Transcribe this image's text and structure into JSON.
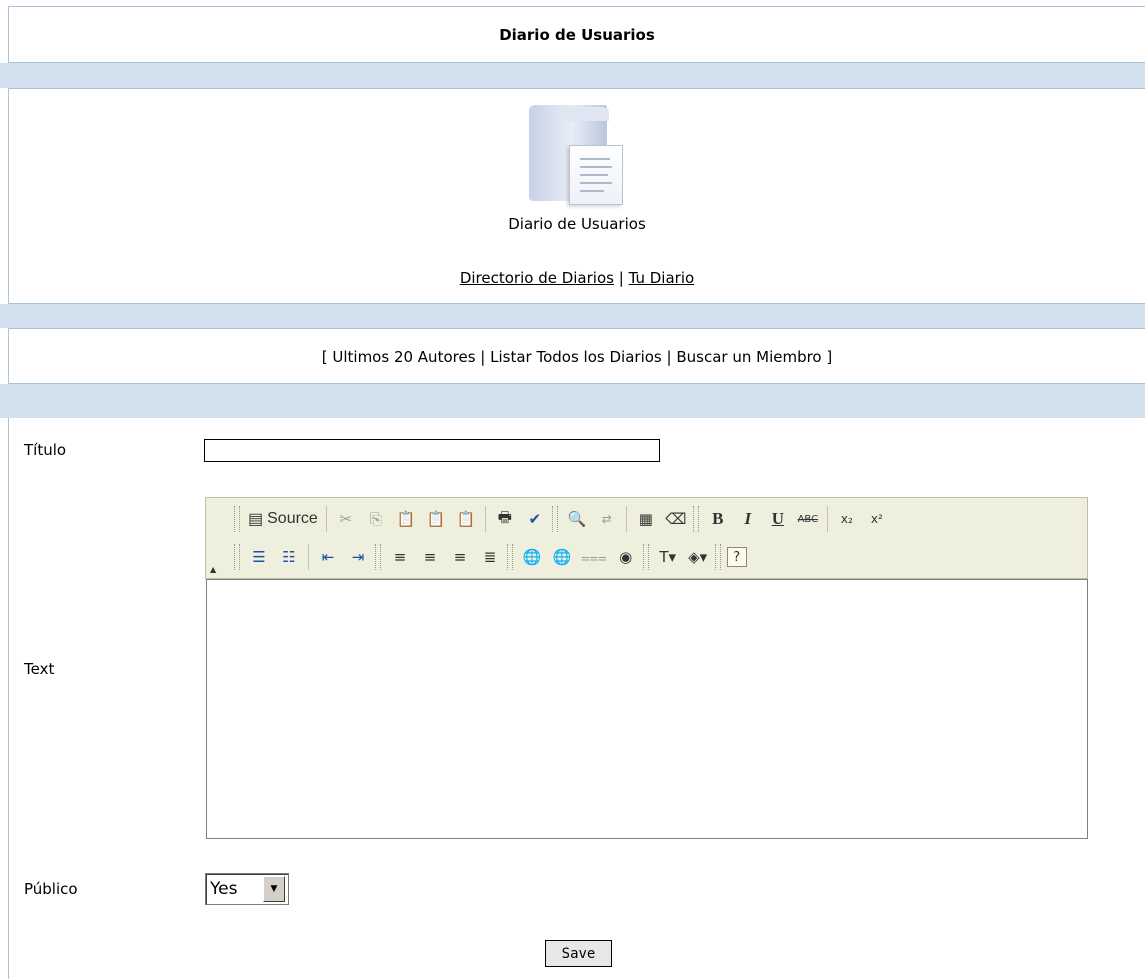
{
  "page_title": "Diario de Usuarios",
  "header": {
    "icon": "folder-document-icon",
    "label": "Diario de Usuarios",
    "links": [
      {
        "label": "Directorio de Diarios"
      },
      {
        "label": "Tu Diario"
      }
    ],
    "link_separator": "|"
  },
  "nav": {
    "open_bracket": "[",
    "close_bracket": "]",
    "separator": "|",
    "items": [
      {
        "label": "Ultimos 20 Autores"
      },
      {
        "label": "Listar Todos los Diarios"
      },
      {
        "label": "Buscar un Miembro"
      }
    ]
  },
  "form": {
    "titulo_label": "Título",
    "titulo_value": "",
    "text_label": "Text",
    "publico_label": "Público",
    "publico_value": "Yes",
    "save_label": "Save"
  },
  "editor": {
    "source_label": "Source",
    "toolbar_row1": [
      "source",
      "cut",
      "copy",
      "paste",
      "paste-text",
      "paste-word",
      "print",
      "spellcheck",
      "find",
      "replace",
      "select-all",
      "remove-format",
      "bold",
      "italic",
      "underline",
      "strikethrough",
      "subscript",
      "superscript"
    ],
    "toolbar_row2": [
      "ordered-list",
      "unordered-list",
      "outdent",
      "indent",
      "align-left",
      "align-center",
      "align-right",
      "justify",
      "link",
      "unlink",
      "horizontal-rule",
      "special-char",
      "text-color",
      "background-color",
      "about"
    ],
    "glyphs": {
      "bold": "B",
      "italic": "I",
      "underline": "U",
      "strikethrough": "ABC",
      "subscript": "x₂",
      "superscript": "x²",
      "about": "?"
    }
  },
  "colors": {
    "band": "#d3e1ee",
    "border": "#a9c3dd",
    "toolbar": "#efefde"
  }
}
